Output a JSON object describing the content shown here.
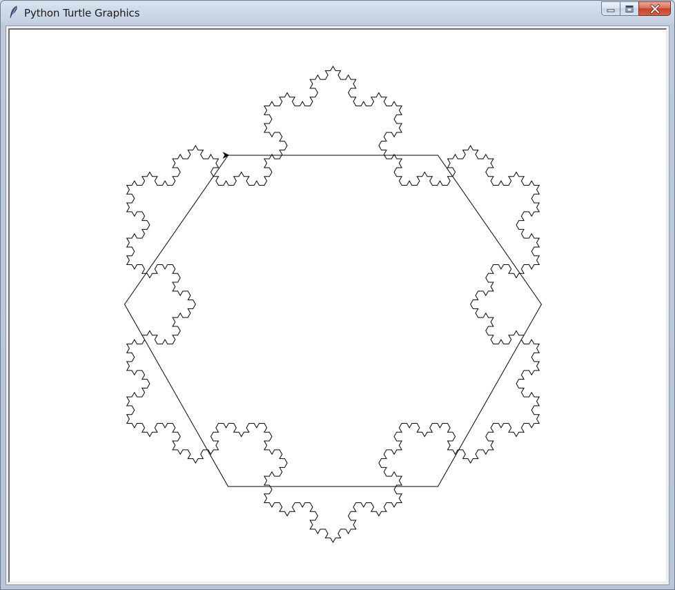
{
  "window": {
    "title": "Python Turtle Graphics",
    "icon": "feather-icon"
  },
  "caption_buttons": {
    "minimize": "minimize-icon",
    "maximize": "maximize-icon",
    "close": "close-icon"
  },
  "canvas": {
    "background": "#ffffff",
    "stroke_color": "#000000",
    "fractal": {
      "shape": "koch-anti-snowflake",
      "outline": "hexagon",
      "recursion_depth": 4
    },
    "turtle": {
      "shape": "arrow",
      "heading": "east"
    }
  }
}
